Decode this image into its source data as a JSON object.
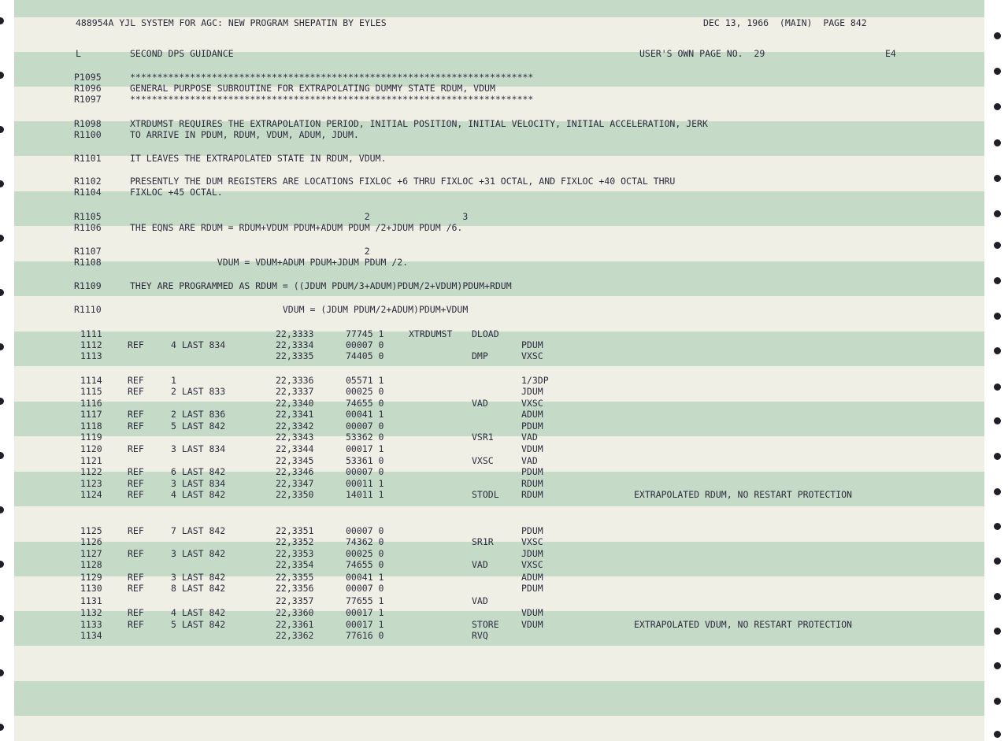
{
  "header": {
    "left": "488954A YJL SYSTEM FOR AGC: NEW PROGRAM SHEPATIN BY EYLES",
    "right": "DEC 13, 1966  (MAIN)  PAGE 842"
  },
  "subheader": {
    "type": "L",
    "section": "SECOND DPS GUIDANCE",
    "user_page": "USER'S OWN PAGE NO.  29",
    "code": "E4"
  },
  "comments": [
    {
      "label": "P1095",
      "text": "**************************************************************************"
    },
    {
      "label": "R1096",
      "text": "GENERAL PURPOSE SUBROUTINE FOR EXTRAPOLATING DUMMY STATE RDUM, VDUM"
    },
    {
      "label": "R1097",
      "text": "**************************************************************************"
    },
    {
      "label": "R1098",
      "text": "XTRDUMST REQUIRES THE EXTRAPOLATION PERIOD, INITIAL POSITION, INITIAL VELOCITY, INITIAL ACCELERATION, JERK"
    },
    {
      "label": "R1100",
      "text": "TO ARRIVE IN PDUM, RDUM, VDUM, ADUM, JDUM."
    },
    {
      "label": "R1101",
      "text": "IT LEAVES THE EXTRAPOLATED STATE IN RDUM, VDUM."
    },
    {
      "label": "R1102",
      "text": "PRESENTLY THE DUM REGISTERS ARE LOCATIONS FIXLOC +6 THRU FIXLOC +31 OCTAL, AND FIXLOC +40 OCTAL THRU"
    },
    {
      "label": "R1104",
      "text": "FIXLOC +45 OCTAL."
    },
    {
      "label": "R1105",
      "text": "                                           2                 3"
    },
    {
      "label": "R1106",
      "text": "THE EQNS ARE RDUM = RDUM+VDUM PDUM+ADUM PDUM /2+JDUM PDUM /6."
    },
    {
      "label": "R1107",
      "text": "                                           2"
    },
    {
      "label": "R1108",
      "text": "                VDUM = VDUM+ADUM PDUM+JDUM PDUM /2."
    },
    {
      "label": "R1109",
      "text": "THEY ARE PROGRAMMED AS RDUM = ((JDUM PDUM/3+ADUM)PDUM/2+VDUM)PDUM+RDUM"
    },
    {
      "label": "R1110",
      "text": "                            VDUM = (JDUM PDUM/2+ADUM)PDUM+VDUM"
    }
  ],
  "code_lines": [
    {
      "num": "1111",
      "ref": "",
      "refinfo": "",
      "addr": "22,3333",
      "word": "77745 1",
      "label": "XTRDUMST",
      "op": "DLOAD",
      "operand": "",
      "comment": ""
    },
    {
      "num": "1112",
      "ref": "REF",
      "refinfo": "4 LAST 834",
      "addr": "22,3334",
      "word": "00007 0",
      "label": "",
      "op": "",
      "operand": "PDUM",
      "comment": ""
    },
    {
      "num": "1113",
      "ref": "",
      "refinfo": "",
      "addr": "22,3335",
      "word": "74405 0",
      "label": "",
      "op": "DMP",
      "operand": "VXSC",
      "comment": ""
    },
    {
      "num": "1114",
      "ref": "REF",
      "refinfo": "1",
      "addr": "22,3336",
      "word": "05571 1",
      "label": "",
      "op": "",
      "operand": "1/3DP",
      "comment": ""
    },
    {
      "num": "1115",
      "ref": "REF",
      "refinfo": "2 LAST 833",
      "addr": "22,3337",
      "word": "00025 0",
      "label": "",
      "op": "",
      "operand": "JDUM",
      "comment": ""
    },
    {
      "num": "1116",
      "ref": "",
      "refinfo": "",
      "addr": "22,3340",
      "word": "74655 0",
      "label": "",
      "op": "VAD",
      "operand": "VXSC",
      "comment": ""
    },
    {
      "num": "1117",
      "ref": "REF",
      "refinfo": "2 LAST 836",
      "addr": "22,3341",
      "word": "00041 1",
      "label": "",
      "op": "",
      "operand": "ADUM",
      "comment": ""
    },
    {
      "num": "1118",
      "ref": "REF",
      "refinfo": "5 LAST 842",
      "addr": "22,3342",
      "word": "00007 0",
      "label": "",
      "op": "",
      "operand": "PDUM",
      "comment": ""
    },
    {
      "num": "1119",
      "ref": "",
      "refinfo": "",
      "addr": "22,3343",
      "word": "53362 0",
      "label": "",
      "op": "VSR1",
      "operand": "VAD",
      "comment": ""
    },
    {
      "num": "1120",
      "ref": "REF",
      "refinfo": "3 LAST 834",
      "addr": "22,3344",
      "word": "00017 1",
      "label": "",
      "op": "",
      "operand": "VDUM",
      "comment": ""
    },
    {
      "num": "1121",
      "ref": "",
      "refinfo": "",
      "addr": "22,3345",
      "word": "53361 0",
      "label": "",
      "op": "VXSC",
      "operand": "VAD",
      "comment": ""
    },
    {
      "num": "1122",
      "ref": "REF",
      "refinfo": "6 LAST 842",
      "addr": "22,3346",
      "word": "00007 0",
      "label": "",
      "op": "",
      "operand": "PDUM",
      "comment": ""
    },
    {
      "num": "1123",
      "ref": "REF",
      "refinfo": "3 LAST 834",
      "addr": "22,3347",
      "word": "00011 1",
      "label": "",
      "op": "",
      "operand": "RDUM",
      "comment": ""
    },
    {
      "num": "1124",
      "ref": "REF",
      "refinfo": "4 LAST 842",
      "addr": "22,3350",
      "word": "14011 1",
      "label": "",
      "op": "STODL",
      "operand": "RDUM",
      "comment": "EXTRAPOLATED RDUM, NO RESTART PROTECTION"
    },
    {
      "num": "1125",
      "ref": "REF",
      "refinfo": "7 LAST 842",
      "addr": "22,3351",
      "word": "00007 0",
      "label": "",
      "op": "",
      "operand": "PDUM",
      "comment": ""
    },
    {
      "num": "1126",
      "ref": "",
      "refinfo": "",
      "addr": "22,3352",
      "word": "74362 0",
      "label": "",
      "op": "SR1R",
      "operand": "VXSC",
      "comment": ""
    },
    {
      "num": "1127",
      "ref": "REF",
      "refinfo": "3 LAST 842",
      "addr": "22,3353",
      "word": "00025 0",
      "label": "",
      "op": "",
      "operand": "JDUM",
      "comment": ""
    },
    {
      "num": "1128",
      "ref": "",
      "refinfo": "",
      "addr": "22,3354",
      "word": "74655 0",
      "label": "",
      "op": "VAD",
      "operand": "VXSC",
      "comment": ""
    },
    {
      "num": "1129",
      "ref": "REF",
      "refinfo": "3 LAST 842",
      "addr": "22,3355",
      "word": "00041 1",
      "label": "",
      "op": "",
      "operand": "ADUM",
      "comment": ""
    },
    {
      "num": "1130",
      "ref": "REF",
      "refinfo": "8 LAST 842",
      "addr": "22,3356",
      "word": "00007 0",
      "label": "",
      "op": "",
      "operand": "PDUM",
      "comment": ""
    },
    {
      "num": "1131",
      "ref": "",
      "refinfo": "",
      "addr": "22,3357",
      "word": "77655 1",
      "label": "",
      "op": "VAD",
      "operand": "",
      "comment": ""
    },
    {
      "num": "1132",
      "ref": "REF",
      "refinfo": "4 LAST 842",
      "addr": "22,3360",
      "word": "00017 1",
      "label": "",
      "op": "",
      "operand": "VDUM",
      "comment": ""
    },
    {
      "num": "1133",
      "ref": "REF",
      "refinfo": "5 LAST 842",
      "addr": "22,3361",
      "word": "00017 1",
      "label": "",
      "op": "STORE",
      "operand": "VDUM",
      "comment": "EXTRAPOLATED VDUM, NO RESTART PROTECTION"
    },
    {
      "num": "1134",
      "ref": "",
      "refinfo": "",
      "addr": "22,3362",
      "word": "77616 0",
      "label": "",
      "op": "RVQ",
      "operand": "",
      "comment": ""
    }
  ]
}
